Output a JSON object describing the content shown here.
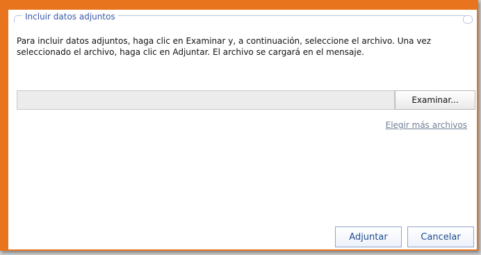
{
  "dialog": {
    "group_title": "Incluir datos adjuntos",
    "description_line1": "Para incluir datos adjuntos, haga clic en Examinar y, a continuación, seleccione el archivo. Una vez",
    "description_line2": "seleccionado el archivo, haga clic en Adjuntar. El archivo se cargará en el mensaje.",
    "browse_label": "Examinar...",
    "more_files_label": "Elegir más archivos",
    "attach_label": "Adjuntar",
    "cancel_label": "Cancelar"
  },
  "colors": {
    "frame": "#e8741e",
    "group_title": "#3a58a8",
    "link": "#6f7f96",
    "button_text": "#1f4d8f"
  }
}
